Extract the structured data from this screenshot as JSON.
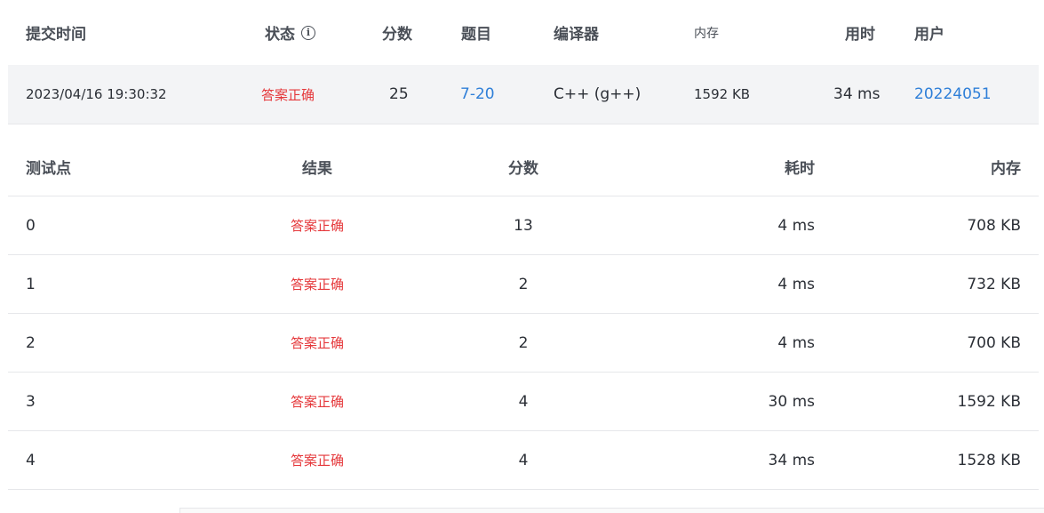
{
  "submission": {
    "headers": {
      "time": "提交时间",
      "status": "状态",
      "score": "分数",
      "problem": "题目",
      "compiler": "编译器",
      "memory": "内存",
      "duration": "用时",
      "user": "用户"
    },
    "row": {
      "time": "2023/04/16 19:30:32",
      "status": "答案正确",
      "score": "25",
      "problem": "7-20",
      "compiler": "C++ (g++)",
      "memory": "1592 KB",
      "duration": "34 ms",
      "user": "20224051"
    }
  },
  "testcases": {
    "headers": {
      "case": "测试点",
      "result": "结果",
      "score": "分数",
      "time": "耗时",
      "memory": "内存"
    },
    "rows": [
      {
        "case": "0",
        "result": "答案正确",
        "score": "13",
        "time": "4 ms",
        "memory": "708 KB"
      },
      {
        "case": "1",
        "result": "答案正确",
        "score": "2",
        "time": "4 ms",
        "memory": "732 KB"
      },
      {
        "case": "2",
        "result": "答案正确",
        "score": "2",
        "time": "4 ms",
        "memory": "700 KB"
      },
      {
        "case": "3",
        "result": "答案正确",
        "score": "4",
        "time": "30 ms",
        "memory": "1592 KB"
      },
      {
        "case": "4",
        "result": "答案正确",
        "score": "4",
        "time": "34 ms",
        "memory": "1528 KB"
      }
    ]
  },
  "colors": {
    "accepted": "#e5383b",
    "link": "#2f7fd8",
    "row_highlight": "#f3f4f6"
  },
  "icons": {
    "status_info": "info-circle-icon"
  }
}
